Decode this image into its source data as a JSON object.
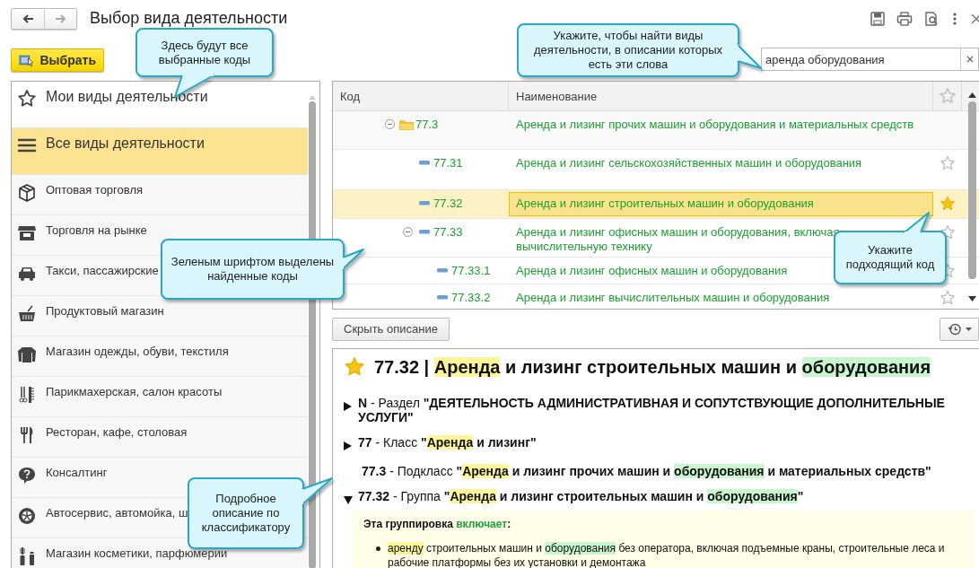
{
  "window": {
    "title": "Выбор вида деятельности"
  },
  "toolbar": {
    "select_button": "Выбрать",
    "search": {
      "value": "аренда оборудования"
    }
  },
  "activity_list": [
    {
      "label": "Мои виды деятельности",
      "kind": "section",
      "selected": false
    },
    {
      "label": "Все виды деятельности",
      "kind": "section",
      "selected": true
    },
    {
      "label": "Оптовая торговля",
      "kind": "category",
      "selected": false
    },
    {
      "label": "Торговля на рынке",
      "kind": "category",
      "selected": false
    },
    {
      "label": "Такси, пассажирские",
      "kind": "category",
      "selected": false
    },
    {
      "label": "Продуктовый магазин",
      "kind": "category",
      "selected": false
    },
    {
      "label": "Магазин одежды, обуви, текстиля",
      "kind": "category",
      "selected": false
    },
    {
      "label": "Парикмахерская, салон красоты",
      "kind": "category",
      "selected": false
    },
    {
      "label": "Ресторан, кафе, столовая",
      "kind": "category",
      "selected": false
    },
    {
      "label": "Консалтинг",
      "kind": "category",
      "selected": false
    },
    {
      "label": "Автосервис, автомойка, ш",
      "kind": "category",
      "selected": false
    },
    {
      "label": "Магазин косметики, парфюмерии",
      "kind": "category",
      "selected": false
    }
  ],
  "codes_table": {
    "columns": [
      "Код",
      "Наименование"
    ],
    "rows": [
      {
        "code": "77.3",
        "name": "Аренда и лизинг прочих машин и оборудования и материальных средств",
        "kind": "group",
        "expanded": true,
        "found": true,
        "selected": false,
        "children": [
          {
            "code": "77.31",
            "name": "Аренда и лизинг сельскохозяйственных машин и оборудования",
            "kind": "item",
            "found": true,
            "starred": false,
            "selected": false
          },
          {
            "code": "77.32",
            "name": "Аренда и лизинг строительных машин и оборудования",
            "kind": "item",
            "found": true,
            "starred": true,
            "selected": true
          },
          {
            "code": "77.33",
            "name": "Аренда и лизинг офисных машин и оборудования, включая вычислительную технику",
            "kind": "item",
            "expanded": true,
            "found": true,
            "starred": false,
            "selected": false,
            "children": [
              {
                "code": "77.33.1",
                "name": "Аренда и лизинг офисных машин и оборудования",
                "kind": "item",
                "found": true,
                "starred": false,
                "selected": false
              },
              {
                "code": "77.33.2",
                "name": "Аренда и лизинг вычислительных машин и оборудования",
                "kind": "item",
                "found": true,
                "starred": false,
                "selected": false
              }
            ]
          }
        ]
      }
    ]
  },
  "description": {
    "hide_button": "Скрыть описание",
    "heading": {
      "starred": true,
      "segments": [
        {
          "text": "77.32 | "
        },
        {
          "text": "Аренда",
          "kind": "term_1"
        },
        {
          "text": " и лизинг строительных машин и "
        },
        {
          "text": "оборудования",
          "kind": "term_2"
        }
      ]
    },
    "lines": [
      {
        "expanded": false,
        "segments": [
          {
            "text": "N",
            "bold": true
          },
          {
            "text": " - Раздел "
          },
          {
            "text": "\"ДЕЯТЕЛЬНОСТЬ АДМИНИСТРАТИВНАЯ И СОПУТСТВУЮЩИЕ ДОПОЛНИТЕЛЬНЫЕ УСЛУГИ\"",
            "bold": true
          }
        ]
      },
      {
        "expanded": false,
        "segments": [
          {
            "text": "77",
            "bold": true
          },
          {
            "text": " - Класс "
          },
          {
            "text": "\"",
            "bold": true
          },
          {
            "text": "Аренда",
            "bold": true,
            "kind": "term_1"
          },
          {
            "text": " и лизинг\"",
            "bold": true
          }
        ]
      },
      {
        "segments": [
          {
            "text": "77.3",
            "bold": true
          },
          {
            "text": " - Подкласс "
          },
          {
            "text": "\"",
            "bold": true
          },
          {
            "text": "Аренда",
            "bold": true,
            "kind": "term_1"
          },
          {
            "text": " и лизинг прочих машин и ",
            "bold": true
          },
          {
            "text": "оборудования",
            "bold": true,
            "kind": "term_2"
          },
          {
            "text": " и материальных средств\"",
            "bold": true
          }
        ]
      },
      {
        "expanded": true,
        "segments": [
          {
            "text": "77.32",
            "bold": true
          },
          {
            "text": " - Группа "
          },
          {
            "text": "\"",
            "bold": true
          },
          {
            "text": "Аренда",
            "bold": true,
            "kind": "term_1"
          },
          {
            "text": " и лизинг строительных машин и ",
            "bold": true
          },
          {
            "text": "оборудования",
            "bold": true,
            "kind": "term_2"
          },
          {
            "text": "\"",
            "bold": true
          }
        ]
      }
    ],
    "includes": {
      "title": [
        {
          "text": "Эта группировка "
        },
        {
          "text": "включает",
          "kind": "keyword"
        },
        {
          "text": ":"
        }
      ],
      "items": [
        [
          {
            "text": "аренду",
            "kind": "term_1"
          },
          {
            "text": " строительных машин и "
          },
          {
            "text": "оборудования",
            "kind": "term_2"
          },
          {
            "text": " без оператора, включая подъемные краны, строительные леса и рабочие платформы без их установки и демонтажа"
          }
        ]
      ]
    }
  },
  "callouts": [
    {
      "text": "Здесь будут все выбранные коды"
    },
    {
      "text": "Укажите, чтобы найти виды деятельности, в описании которых есть эти слова"
    },
    {
      "text": "Зеленым шрифтом выделены найденные коды"
    },
    {
      "text": "Укажите подходящий код"
    },
    {
      "text": "Подробное описание по классификатору"
    }
  ]
}
